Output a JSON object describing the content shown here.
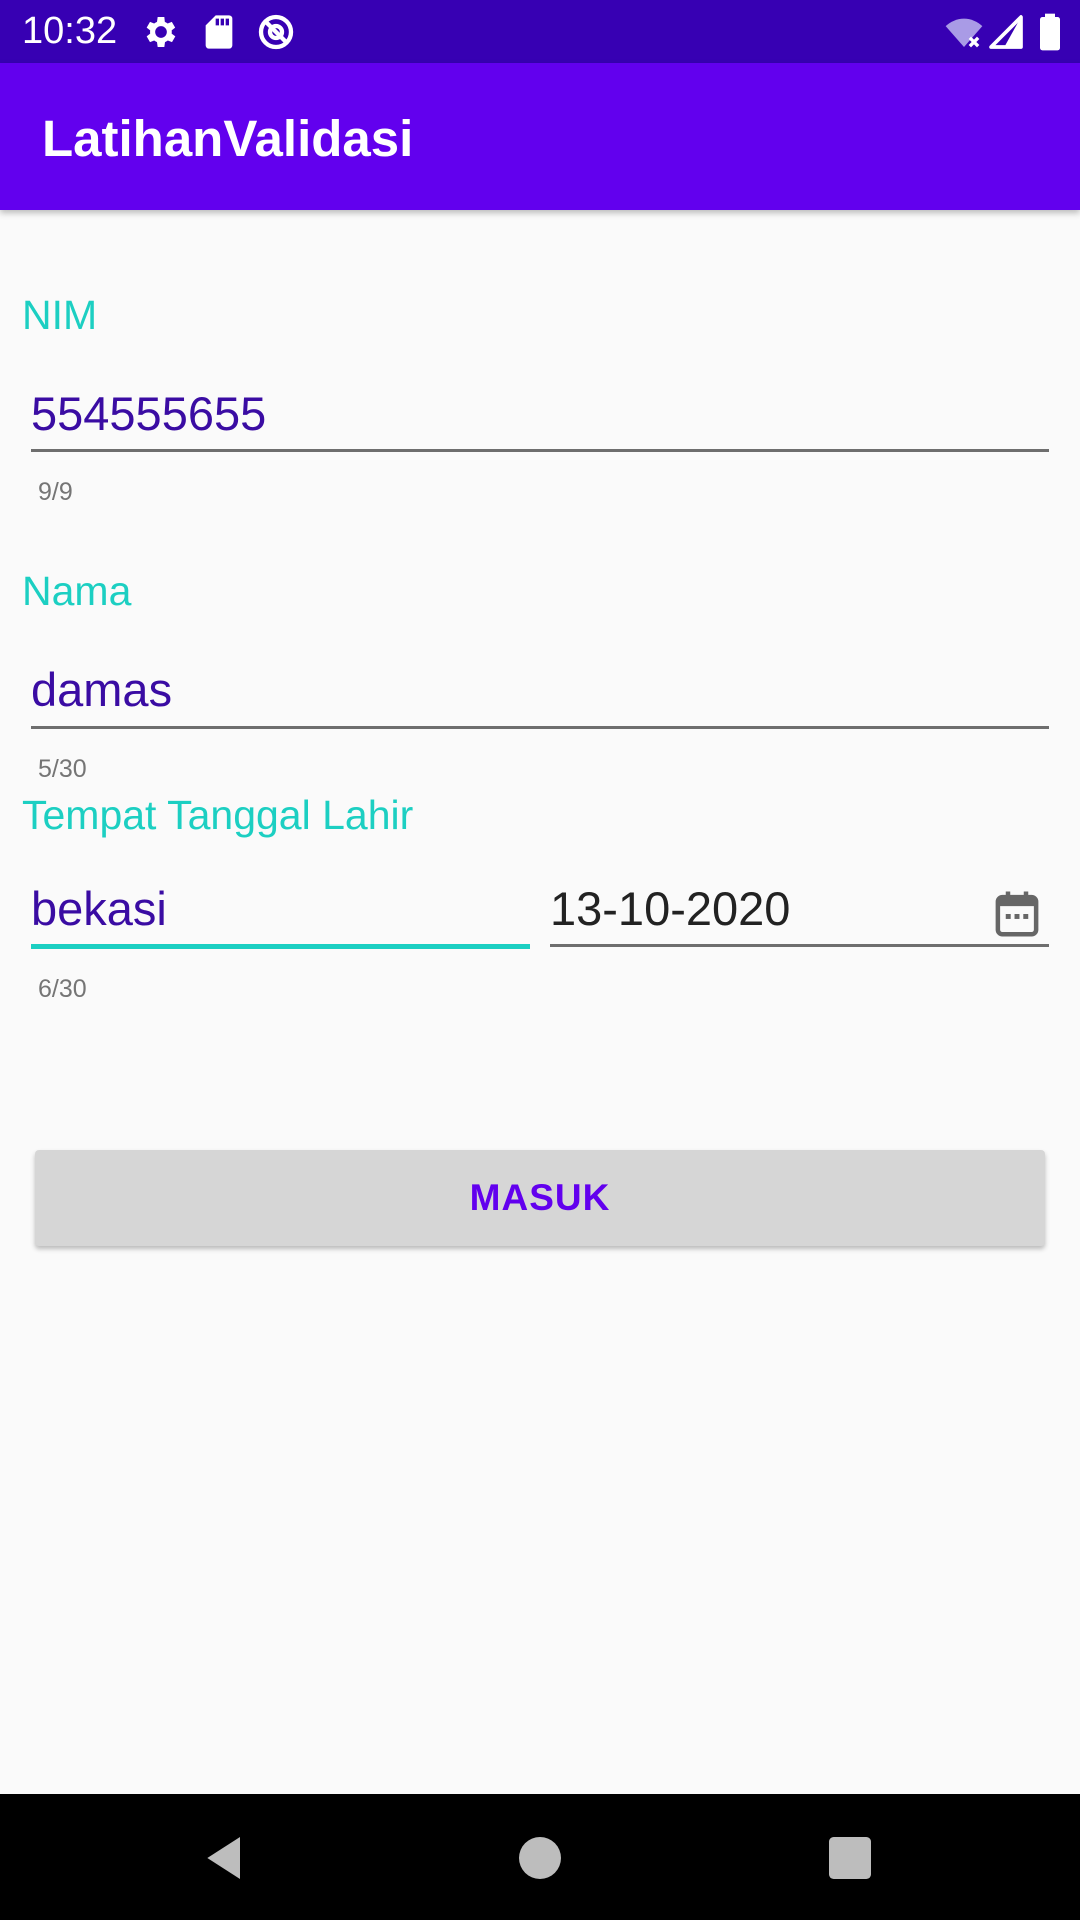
{
  "status_bar": {
    "time": "10:32",
    "icons": [
      "settings-icon",
      "sd-card-icon",
      "data-saver-icon",
      "wifi-off-icon",
      "signal-icon",
      "battery-icon"
    ]
  },
  "app_bar": {
    "title": "LatihanValidasi"
  },
  "form": {
    "nim": {
      "label": "NIM",
      "value": "554555655",
      "counter": "9/9"
    },
    "nama": {
      "label": "Nama",
      "value": "damas",
      "counter": "5/30"
    },
    "ttl": {
      "label": "Tempat Tanggal Lahir",
      "tempat": {
        "value": "bekasi",
        "counter": "6/30"
      },
      "tanggal": {
        "value": "13-10-2020",
        "icon": "calendar-icon"
      }
    },
    "submit_label": "MASUK"
  },
  "nav_bar": {
    "icons": [
      "back-icon",
      "home-icon",
      "recents-icon"
    ]
  },
  "colors": {
    "status_bar": "#3700b3",
    "app_bar": "#6200ee",
    "accent": "#1ccfc2",
    "input_text": "#3a0ca3",
    "button_bg": "#d6d6d6"
  }
}
